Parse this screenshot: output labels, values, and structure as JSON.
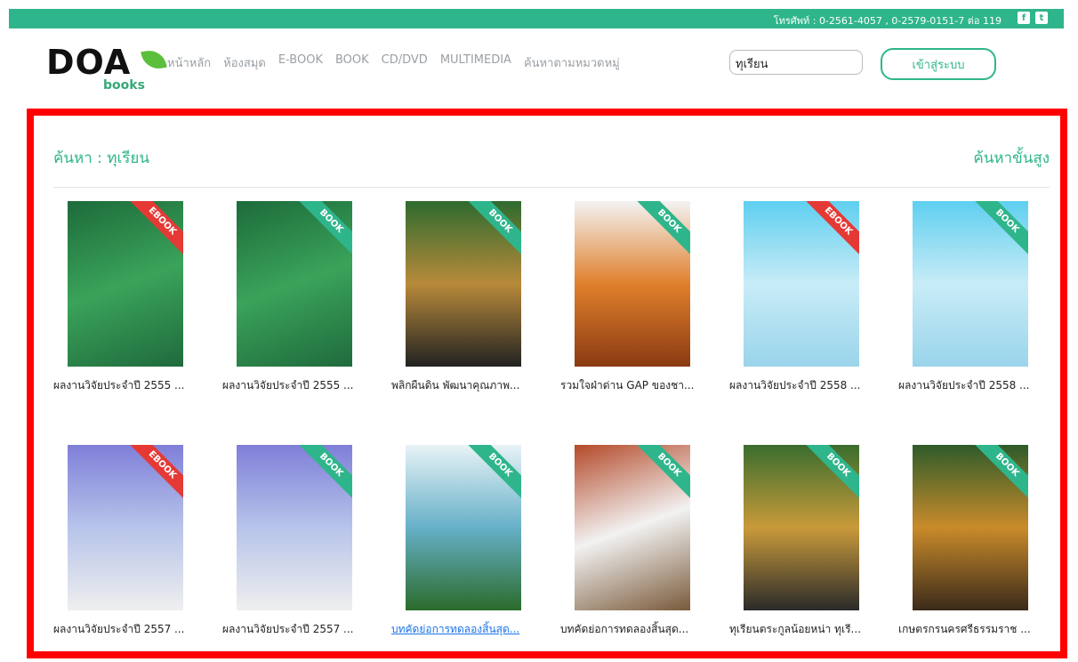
{
  "topbar": {
    "phone": "โทรศัพท์ : 0-2561-4057 , 0-2579-0151-7 ต่อ 119",
    "social": [
      "facebook-icon",
      "twitter-icon"
    ]
  },
  "logo": {
    "main": "DOA",
    "sub": "books"
  },
  "nav": [
    "หน้าหลัก",
    "ห้องสมุด",
    "E-BOOK",
    "BOOK",
    "CD/DVD",
    "MULTIMEDIA",
    "ค้นหาตามหมวดหมู่"
  ],
  "search": {
    "value": "ทุเรียน"
  },
  "login": "เข้าสู่ระบบ",
  "results": {
    "title": "ค้นหา : ทุเรียน",
    "advanced": "ค้นหาขั้นสูง",
    "items": [
      {
        "title": "ผลงานวิจัยประจำปี 2555 ...",
        "type": "EBOOK"
      },
      {
        "title": "ผลงานวิจัยประจำปี 2555 ...",
        "type": "BOOK"
      },
      {
        "title": "พลิกผืนดิน พัฒนาคุณภาพ...",
        "type": "BOOK"
      },
      {
        "title": "รวมใจฝ่าด่าน GAP ของชา...",
        "type": "BOOK"
      },
      {
        "title": "ผลงานวิจัยประจำปี 2558 ...",
        "type": "EBOOK"
      },
      {
        "title": "ผลงานวิจัยประจำปี 2558 ...",
        "type": "BOOK"
      },
      {
        "title": "ผลงานวิจัยประจำปี 2557 ...",
        "type": "EBOOK"
      },
      {
        "title": "ผลงานวิจัยประจำปี 2557 ...",
        "type": "BOOK"
      },
      {
        "title": "บทคัดย่อการทดลองสิ้นสุด...",
        "type": "BOOK"
      },
      {
        "title": "บทคัดย่อการทดลองสิ้นสุด...",
        "type": "BOOK"
      },
      {
        "title": "ทุเรียนตระกูลน้อยหน่า ทุเรี...",
        "type": "BOOK"
      },
      {
        "title": "เกษตรกรนครศรีธรรมราช ...",
        "type": "BOOK"
      }
    ]
  }
}
